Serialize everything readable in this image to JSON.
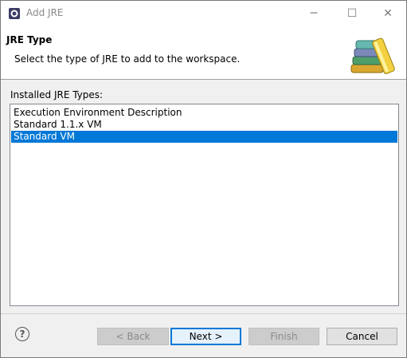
{
  "window": {
    "title": "Add JRE",
    "controls": {
      "minimize": "─",
      "maximize": "☐",
      "close": "✕"
    }
  },
  "header": {
    "title": "JRE Type",
    "description": "Select the type of JRE to add to the workspace.",
    "art_icon": "books-icon"
  },
  "list": {
    "label": "Installed JRE Types:",
    "items": [
      {
        "label": "Execution Environment Description",
        "selected": false
      },
      {
        "label": "Standard 1.1.x VM",
        "selected": false
      },
      {
        "label": "Standard VM",
        "selected": true
      }
    ]
  },
  "buttons": {
    "help": "?",
    "back": "< Back",
    "next": "Next >",
    "finish": "Finish",
    "cancel": "Cancel"
  },
  "colors": {
    "selection": "#0078d7",
    "header_bg": "#ffffff",
    "dialog_bg": "#f0f0f0"
  }
}
